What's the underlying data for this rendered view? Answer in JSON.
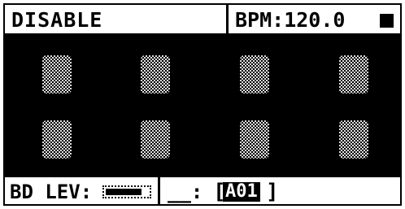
{
  "header": {
    "mode": "DISABLE",
    "bpm": "BPM:120.0",
    "transport_icon": "stop-icon"
  },
  "pads": {
    "count": 8,
    "rows": 2,
    "columns": 4
  },
  "footer": {
    "param_label": "BD LEV:",
    "level": 0.85,
    "slot_label": "__:",
    "bracket_open": "[",
    "slot_value": "A01",
    "bracket_close": "]"
  }
}
